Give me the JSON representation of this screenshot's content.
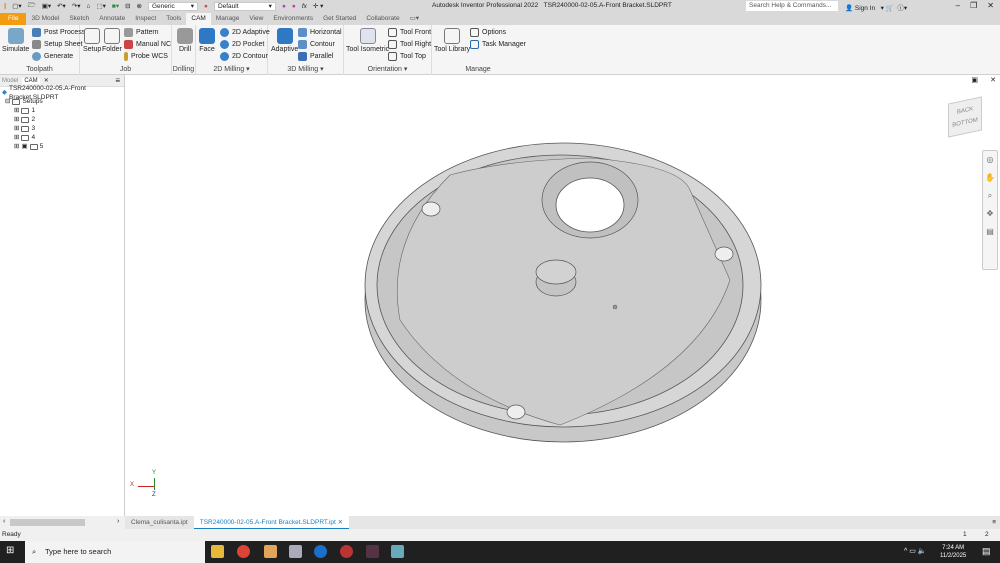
{
  "app": {
    "title": "Autodesk Inventor Professional 2022",
    "document": "TSR240000-02-05.A-Front Bracket.SLDPRT",
    "search_placeholder": "Search Help & Commands...",
    "sign_in": "Sign In",
    "material": "Generic",
    "appearance": "Default"
  },
  "tabs": [
    "File",
    "3D Model",
    "Sketch",
    "Annotate",
    "Inspect",
    "Tools",
    "CAM",
    "Manage",
    "View",
    "Environments",
    "Get Started",
    "Collaborate"
  ],
  "ribbon": {
    "toolpath": {
      "label": "Toolpath",
      "simulate": "Simulate",
      "post_process": "Post Process",
      "setup_sheet": "Setup Sheet",
      "generate": "Generate"
    },
    "job": {
      "label": "Job",
      "setup": "Setup",
      "folder": "Folder",
      "pattern": "Pattern",
      "manual_nc": "Manual NC",
      "probe_wcs": "Probe WCS"
    },
    "drilling": {
      "label": "Drilling",
      "drill": "Drill"
    },
    "milling2d": {
      "label": "2D Milling",
      "face": "Face",
      "adaptive": "2D Adaptive",
      "pocket": "2D Pocket",
      "contour": "2D Contour"
    },
    "milling3d": {
      "label": "3D Milling",
      "adaptive": "Adaptive",
      "horizontal": "Horizontal",
      "contour": "Contour",
      "parallel": "Parallel"
    },
    "orientation": {
      "label": "Orientation",
      "iso": "Tool Isometric",
      "front": "Tool Front",
      "right": "Tool Right",
      "top": "Tool Top"
    },
    "manage": {
      "label": "Manage",
      "library": "Tool Library",
      "options": "Options",
      "task_manager": "Task Manager"
    }
  },
  "browser": {
    "tabs": [
      "Model",
      "CAM"
    ],
    "root": "TSR240000-02-05.A-Front Bracket.SLDPRT",
    "setups": "Setups",
    "items": [
      "1",
      "2",
      "3",
      "4",
      "5"
    ]
  },
  "viewcube": {
    "face1": "BACK",
    "face2": "BOTTOM"
  },
  "triad": {
    "x": "X",
    "y": "Y",
    "z": "Z"
  },
  "doc_tabs": [
    "Clema_culisanta.ipt",
    "TSR240000-02-05.A-Front Bracket.SLDPRT.ipt"
  ],
  "status": {
    "text": "Ready",
    "page1": "1",
    "page2": "2"
  },
  "taskbar": {
    "search": "Type here to search",
    "time": "7:24 AM",
    "date": "11/2/2025"
  }
}
